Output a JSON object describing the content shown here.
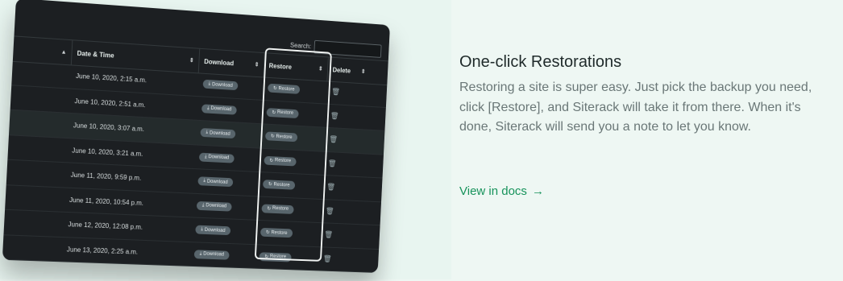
{
  "table": {
    "search_label": "Search:",
    "columns": [
      {
        "label": ""
      },
      {
        "label": "Date & Time"
      },
      {
        "label": "Download"
      },
      {
        "label": "Restore"
      },
      {
        "label": "Delete"
      }
    ],
    "rows": [
      {
        "datetime": "June 10, 2020, 2:15 a.m.",
        "download": "Download",
        "restore": "Restore"
      },
      {
        "datetime": "June 10, 2020, 2:51 a.m.",
        "download": "Download",
        "restore": "Restore"
      },
      {
        "datetime": "June 10, 2020, 3:07 a.m.",
        "download": "Download",
        "restore": "Restore"
      },
      {
        "datetime": "June 10, 2020, 3:21 a.m.",
        "download": "Download",
        "restore": "Restore"
      },
      {
        "datetime": "June 11, 2020, 9:59 p.m.",
        "download": "Download",
        "restore": "Restore"
      },
      {
        "datetime": "June 11, 2020, 10:54 p.m.",
        "download": "Download",
        "restore": "Restore"
      },
      {
        "datetime": "June 12, 2020, 12:08 p.m.",
        "download": "Download",
        "restore": "Restore"
      },
      {
        "datetime": "June 13, 2020, 2:25 a.m.",
        "download": "Download",
        "restore": "Restore"
      }
    ],
    "icons": {
      "sort": "sort-icon",
      "download": "download-icon",
      "restore": "restore-icon",
      "delete": "trash-icon"
    }
  },
  "feature": {
    "title": "One-click Restorations",
    "description": "Restoring a site is super easy. Just pick the backup you need,\nclick [Restore], and Siterack will take it from there. When it's\ndone, Siterack will send you a note to let you know.",
    "link_label": "View in docs",
    "link_arrow": "→"
  },
  "colors": {
    "accent": "#17935b",
    "panel": "#1c1f22",
    "pill": "#58656c"
  }
}
